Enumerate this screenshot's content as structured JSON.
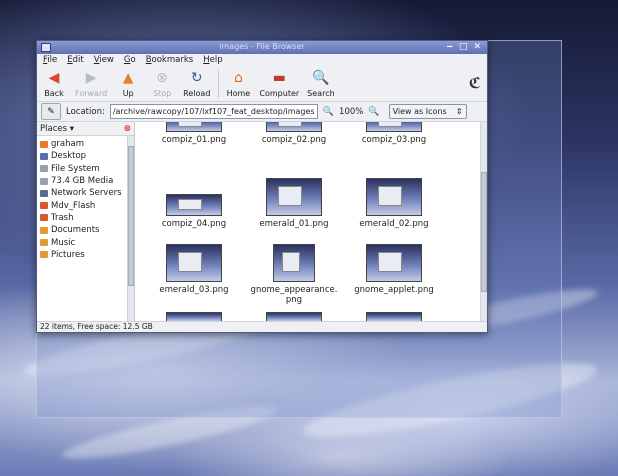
{
  "window": {
    "title": "images - File Browser"
  },
  "menubar": {
    "items": [
      "File",
      "Edit",
      "View",
      "Go",
      "Bookmarks",
      "Help"
    ]
  },
  "toolbar": {
    "back": "Back",
    "forward": "Forward",
    "up": "Up",
    "stop": "Stop",
    "reload": "Reload",
    "home": "Home",
    "computer": "Computer",
    "search": "Search"
  },
  "location": {
    "label": "Location:",
    "path": "/archive/rawcopy/107/lxf107_feat_desktop/images",
    "zoom": "100%",
    "view_mode": "View as Icons"
  },
  "sidebar": {
    "header": "Places",
    "items": [
      {
        "label": "graham",
        "icon": "home-icon",
        "color": "#e77b2a"
      },
      {
        "label": "Desktop",
        "icon": "desktop-icon",
        "color": "#5b6ea8"
      },
      {
        "label": "File System",
        "icon": "drive-icon",
        "color": "#9aa0ab"
      },
      {
        "label": "73.4 GB Media",
        "icon": "drive-icon",
        "color": "#9aa0ab"
      },
      {
        "label": "Network Servers",
        "icon": "network-icon",
        "color": "#5c6b8a"
      },
      {
        "label": "Mdv_Flash",
        "icon": "usb-drive-icon",
        "color": "#d9572c"
      },
      {
        "label": "Trash",
        "icon": "trash-icon",
        "color": "#d45a2a"
      },
      {
        "label": "Documents",
        "icon": "folder-icon",
        "color": "#e09a3a"
      },
      {
        "label": "Music",
        "icon": "folder-icon",
        "color": "#e09a3a"
      },
      {
        "label": "Pictures",
        "icon": "folder-icon",
        "color": "#e09a3a"
      }
    ]
  },
  "files": [
    {
      "name": "compiz_01.png"
    },
    {
      "name": "compiz_02.png"
    },
    {
      "name": "compiz_03.png"
    },
    {
      "name": "compiz_04.png"
    },
    {
      "name": "emerald_01.png"
    },
    {
      "name": "emerald_02.png"
    },
    {
      "name": "emerald_03.png"
    },
    {
      "name": "gnome_appearance.\npng"
    },
    {
      "name": "gnome_applet.png"
    }
  ],
  "status": {
    "text": "22 items, Free space: 12.5 GB"
  }
}
